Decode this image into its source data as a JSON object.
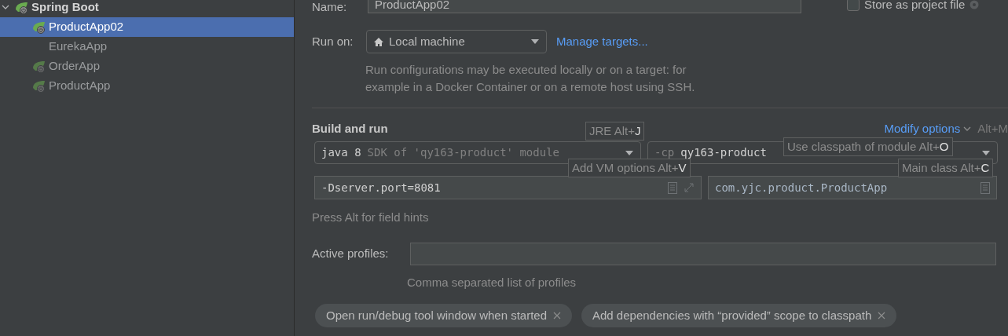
{
  "sidebar": {
    "tree": [
      {
        "label": "Spring Boot",
        "kind": "spring",
        "expanded": true,
        "children": [
          {
            "label": "ProductApp02",
            "kind": "spring",
            "selected": true
          },
          {
            "label": "EurekaApp",
            "kind": "plain",
            "selected": false
          },
          {
            "label": "OrderApp",
            "kind": "spring-dim",
            "selected": false
          },
          {
            "label": "ProductApp",
            "kind": "spring-dim",
            "selected": false
          }
        ]
      }
    ]
  },
  "form": {
    "name": {
      "label": "Name:",
      "value": "ProductApp02"
    },
    "store_as_project_file": {
      "label": "Store as project file",
      "checked": false
    },
    "run_on": {
      "label": "Run on:",
      "value": "Local machine",
      "link": "Manage targets...",
      "description": "Run configurations may be executed locally or on a target: for example in a Docker Container or on a remote host using SSH."
    },
    "build_and_run": {
      "title": "Build and run",
      "modify_options": {
        "label": "Modify options",
        "shortcut": "Alt+M"
      },
      "jre": {
        "value": "java 8",
        "hint": "SDK of 'qy163-product' module"
      },
      "classpath": {
        "prefix": "-cp",
        "value": "qy163-product"
      },
      "vm_options": "-Dserver.port=8081",
      "main_class": "com.yjc.product.ProductApp",
      "hint_text": "Press Alt for field hints",
      "tooltips": [
        {
          "text": "JRE Alt+",
          "key": "J"
        },
        {
          "text": "Use classpath of module Alt+",
          "key": "O"
        },
        {
          "text": "Add VM options Alt+",
          "key": "V"
        },
        {
          "text": "Main class Alt+",
          "key": "C"
        }
      ]
    },
    "active_profiles": {
      "label": "Active profiles:",
      "description": "Comma separated list of profiles"
    },
    "chips": [
      {
        "label": "Open run/debug tool window when started"
      },
      {
        "label": "Add dependencies with “provided” scope to classpath"
      }
    ]
  }
}
